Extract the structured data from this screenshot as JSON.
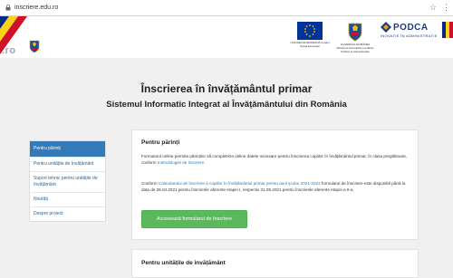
{
  "browser": {
    "url": "inscriere.edu.ro"
  },
  "header": {
    "brand_suffix": ".ro",
    "logo_eu_caption": "UNIUNEA EUROPEANĂ Fondul Social European",
    "logo_gov_caption": "GUVERNUL ROMÂNIEI Ministerul Dezvoltării Lucrărilor Publice și Administrației",
    "podca_name": "PODCA",
    "podca_tagline": "INOVAȚIE ÎN ADMINISTRAȚIE"
  },
  "page": {
    "title": "Înscrierea în învățământul primar",
    "subtitle": "Sistemul Informatic Integrat al Învățământului din România"
  },
  "sidebar": {
    "items": [
      {
        "label": "Pentru părinți"
      },
      {
        "label": "Pentru unitățile de învățământ"
      },
      {
        "label": "Suport tehnic pentru unitățile de învățământ"
      },
      {
        "label": "Noutăți"
      },
      {
        "label": "Despre proiect"
      }
    ]
  },
  "panel": {
    "heading": "Pentru părinți",
    "p1_text": "Formularul online permite părinților să completeze online datele necesare pentru înscrierea copiilor în învățământul primar, în clasa pregătitoare, conform ",
    "p1_link": "metodologiei de înscriere",
    "p1_end": ".",
    "p2_start": "Conform ",
    "p2_link": "Calendarului de înscriere a copiilor în învățământul primar pentru anul școlar 2021-2022",
    "p2_text": " formularul de înscriere este disponibil până la data de 28.04.2021 pentru înscrierile aferente etapei I, respectiv 31.05.2021 pentru înscrierile aferente etapei a II-a.",
    "button_label": "Accesează formularul de înscriere"
  },
  "panel2": {
    "heading": "Pentru unitățile de învățământ"
  },
  "colors": {
    "accent": "#337ab7",
    "button": "#5cb85c",
    "link": "#2a7ab8"
  }
}
